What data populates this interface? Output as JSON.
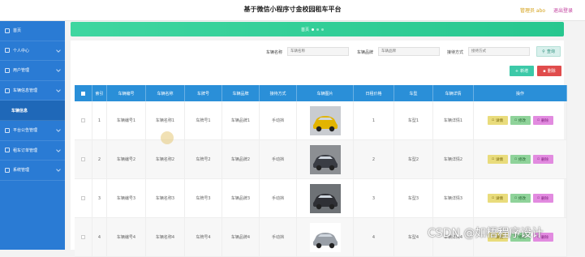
{
  "header": {
    "title": "基于微信小程序寸金校园租车平台",
    "admin": "管理员 abo",
    "logout": "退出登录"
  },
  "sidebar": {
    "items": [
      {
        "label": "首页",
        "icon": "home-icon",
        "has_children": false
      },
      {
        "label": "个人中心",
        "icon": "user-icon",
        "has_children": true
      },
      {
        "label": "用户管理",
        "icon": "users-icon",
        "has_children": true
      },
      {
        "label": "车辆信息管理",
        "icon": "car-icon",
        "has_children": true
      },
      {
        "label": "车辆信息",
        "icon": "",
        "has_children": false,
        "sub": true
      },
      {
        "label": "平台公告管理",
        "icon": "notice-icon",
        "has_children": true
      },
      {
        "label": "租车订单管理",
        "icon": "order-icon",
        "has_children": true
      },
      {
        "label": "系统管理",
        "icon": "gear-icon",
        "has_children": true
      }
    ]
  },
  "breadcrumb": {
    "home": "首页"
  },
  "search": {
    "name_label": "车辆名称",
    "name_placeholder": "车辆名称",
    "brand_label": "车辆品牌",
    "brand_placeholder": "车辆品牌",
    "mode_label": "接待方式",
    "mode_placeholder": "接待方式",
    "query_btn": "查询"
  },
  "actions": {
    "add": "新增",
    "delete": "删除"
  },
  "table": {
    "headers": [
      "索引",
      "车辆编号",
      "车辆名称",
      "车牌号",
      "车辆品牌",
      "接待方式",
      "车辆图片",
      "日租价格",
      "车型",
      "车辆详情",
      "操作"
    ],
    "rows": [
      {
        "index": "1",
        "code": "车辆编号1",
        "name": "车辆名称1",
        "plate": "车牌号1",
        "brand": "车辆品牌1",
        "mode": "手动挡",
        "price": "1",
        "type": "车型1",
        "detail": "车辆详情1",
        "car_color": "#e2b400"
      },
      {
        "index": "2",
        "code": "车辆编号2",
        "name": "车辆名称2",
        "plate": "车牌号2",
        "brand": "车辆品牌2",
        "mode": "手动挡",
        "price": "2",
        "type": "车型2",
        "detail": "车辆详情2",
        "car_color": "#3a3d44"
      },
      {
        "index": "3",
        "code": "车辆编号3",
        "name": "车辆名称3",
        "plate": "车牌号3",
        "brand": "车辆品牌3",
        "mode": "手动挡",
        "price": "3",
        "type": "车型3",
        "detail": "车辆详情3",
        "car_color": "#2f3035"
      },
      {
        "index": "4",
        "code": "车辆编号4",
        "name": "车辆名称4",
        "plate": "车牌号4",
        "brand": "车辆品牌4",
        "mode": "手动挡",
        "price": "4",
        "type": "车型4",
        "detail": "车辆详情4",
        "car_color": "#9aa0a8"
      }
    ],
    "op_detail": "详情",
    "op_edit": "修改",
    "op_delete": "删除"
  },
  "watermark": "CSDN @如梧程序设计",
  "colors": {
    "sidebar": "#2a7bd4",
    "banner": "#27c78f",
    "table_header": "#2a8fd8",
    "add": "#3cc9a8",
    "delete": "#e04c4c"
  }
}
